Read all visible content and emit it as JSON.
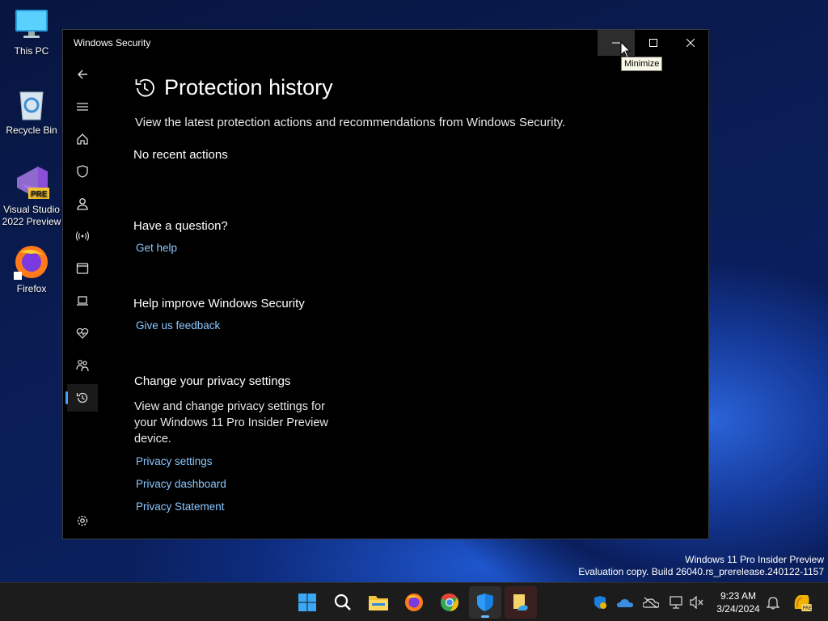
{
  "desktop": {
    "icons": [
      {
        "label": "This PC",
        "icon": "monitor-icon"
      },
      {
        "label": "Recycle Bin",
        "icon": "recycle-bin-icon"
      },
      {
        "label_line1": "Visual Studio",
        "label_line2": "2022 Preview",
        "icon": "visual-studio-icon",
        "badge": "PRE"
      },
      {
        "label": "Firefox",
        "icon": "firefox-icon"
      }
    ],
    "watermark_line1": "Windows 11 Pro Insider Preview",
    "watermark_line2": "Evaluation copy. Build 26040.rs_prerelease.240122-1157"
  },
  "window": {
    "title": "Windows Security",
    "tooltip": "Minimize",
    "nav_items": [
      "back-icon",
      "menu-icon",
      "home-icon",
      "shield-icon",
      "account-icon",
      "network-icon",
      "app-browser-icon",
      "device-security-icon",
      "health-icon",
      "family-icon",
      "history-icon",
      "settings-icon"
    ],
    "page_title": "Protection history",
    "description": "View the latest protection actions and recommendations from Windows Security.",
    "no_actions": "No recent actions",
    "question_heading": "Have a question?",
    "get_help": "Get help",
    "improve_heading": "Help improve Windows Security",
    "feedback": "Give us feedback",
    "privacy_heading": "Change your privacy settings",
    "privacy_text": "View and change privacy settings for your Windows 11 Pro Insider Preview device.",
    "privacy_settings": "Privacy settings",
    "privacy_dashboard": "Privacy dashboard",
    "privacy_statement": "Privacy Statement"
  },
  "taskbar": {
    "apps": [
      "start-icon",
      "search-icon",
      "file-explorer-icon",
      "firefox-icon",
      "chrome-icon",
      "windows-security-icon",
      "notes-icon"
    ],
    "time": "9:23 AM",
    "date": "3/24/2024"
  },
  "colors": {
    "accent": "#4a9eff",
    "link": "#8cc7ff",
    "window_bg": "#000000",
    "taskbar": "#1c1c1c"
  }
}
